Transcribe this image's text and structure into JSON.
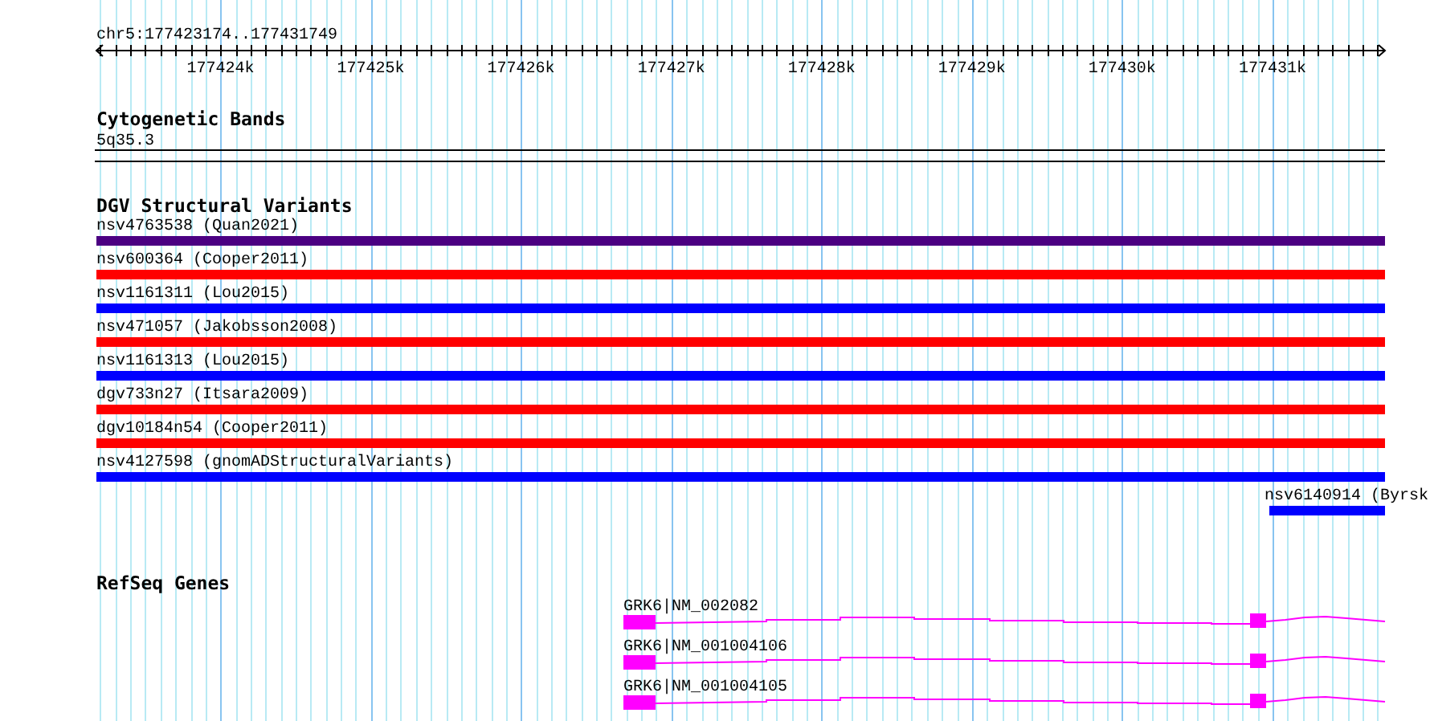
{
  "ruler": {
    "region": "chr5:177423174..177431749",
    "tick_labels": [
      "177424k",
      "177425k",
      "177426k",
      "177427k",
      "177428k",
      "177429k",
      "177430k",
      "177431k"
    ]
  },
  "cytogenetic_bands": {
    "title": "Cytogenetic Bands",
    "band": "5q35.3"
  },
  "dgv_variants": {
    "title": "DGV Structural Variants",
    "features": [
      {
        "label": "nsv4763538 (Quan2021)",
        "color": "#4b0082"
      },
      {
        "label": "nsv600364 (Cooper2011)",
        "color": "#ff0000"
      },
      {
        "label": "nsv1161311 (Lou2015)",
        "color": "#0000ff"
      },
      {
        "label": "nsv471057 (Jakobsson2008)",
        "color": "#ff0000"
      },
      {
        "label": "nsv1161313 (Lou2015)",
        "color": "#0000ff"
      },
      {
        "label": "dgv733n27 (Itsara2009)",
        "color": "#ff0000"
      },
      {
        "label": "dgv10184n54 (Cooper2011)",
        "color": "#ff0000"
      },
      {
        "label": "nsv4127598 (gnomADStructuralVariants)",
        "color": "#0000ff"
      },
      {
        "label": "nsv6140914 (Byrsk",
        "color": "#0000ff"
      }
    ]
  },
  "refseq_genes": {
    "title": "RefSeq Genes",
    "transcripts": [
      {
        "label": "GRK6|NM_002082"
      },
      {
        "label": "GRK6|NM_001004106"
      },
      {
        "label": "GRK6|NM_001004105"
      }
    ]
  }
}
